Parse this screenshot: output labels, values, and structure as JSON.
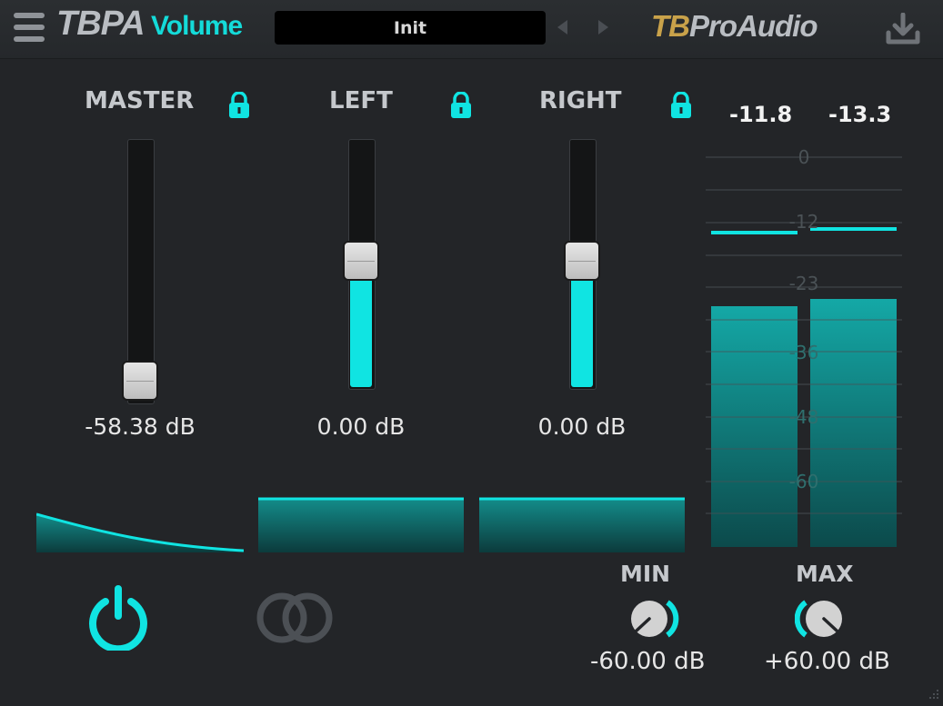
{
  "header": {
    "menu_icon": "hamburger-menu-icon",
    "title_brand": "TBPA",
    "title_product": "Volume",
    "preset_name": "Init",
    "prev_icon": "chevron-left-icon",
    "next_icon": "chevron-right-icon",
    "logo_tb": "TB",
    "logo_rest": "ProAudio",
    "download_icon": "download-icon"
  },
  "channels": {
    "master": {
      "label": "MASTER",
      "value": "-58.38 dB",
      "lock_icon": "lock-icon",
      "fader_level": 0.06
    },
    "left": {
      "label": "LEFT",
      "value": "0.00 dB",
      "lock_icon": "lock-icon",
      "fader_level": 0.5
    },
    "right": {
      "label": "RIGHT",
      "value": "0.00 dB",
      "lock_icon": "lock-icon",
      "fader_level": 0.5
    }
  },
  "meter": {
    "peak_left": "-11.8",
    "peak_right": "-13.3",
    "scale": [
      "0",
      "-12",
      "-23",
      "-36",
      "-48",
      "-60"
    ]
  },
  "range": {
    "min_label": "MIN",
    "min_value": "-60.00 dB",
    "max_label": "MAX",
    "max_value": "+60.00 dB"
  },
  "bottom": {
    "power_icon": "power-icon",
    "link_icon": "stereo-link-icon"
  },
  "colors": {
    "accent": "#10e4e2",
    "background": "#232528",
    "brand_gold": "#c9a24a"
  }
}
